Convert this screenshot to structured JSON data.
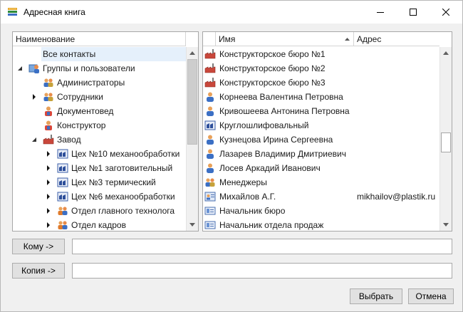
{
  "window": {
    "title": "Адресная книга"
  },
  "left_panel": {
    "column_header": "Наименование",
    "rows": [
      {
        "label": "Все контакты",
        "icon": "none",
        "expander": "none",
        "selected": true
      },
      {
        "label": "Группы и пользователи",
        "icon": "groups-users-icon",
        "expander": "expanded"
      },
      {
        "label": "Администраторы",
        "icon": "group-icon",
        "expander": "none"
      },
      {
        "label": "Сотрудники",
        "icon": "group-icon",
        "expander": "collapsed"
      },
      {
        "label": "Документовед",
        "icon": "user-role-icon",
        "expander": "none"
      },
      {
        "label": "Конструктор",
        "icon": "user-role-icon",
        "expander": "none"
      },
      {
        "label": "Завод",
        "icon": "factory-icon",
        "expander": "expanded"
      },
      {
        "label": "Цех №10 механообработки",
        "icon": "workshop-icon",
        "expander": "collapsed"
      },
      {
        "label": "Цех №1 заготовительный",
        "icon": "workshop-icon",
        "expander": "collapsed"
      },
      {
        "label": "Цех №3 термический",
        "icon": "workshop-icon",
        "expander": "collapsed"
      },
      {
        "label": "Цех №6 механообработки",
        "icon": "workshop-icon",
        "expander": "collapsed"
      },
      {
        "label": "Отдел главного технолога",
        "icon": "department-icon",
        "expander": "collapsed"
      },
      {
        "label": "Отдел кадров",
        "icon": "department-icon",
        "expander": "collapsed"
      }
    ]
  },
  "right_panel": {
    "columns": {
      "name": "Имя",
      "address": "Адрес"
    },
    "rows": [
      {
        "name": "Конструкторское бюро №1",
        "address": "",
        "icon": "bureau-icon"
      },
      {
        "name": "Конструкторское бюро №2",
        "address": "",
        "icon": "bureau-icon"
      },
      {
        "name": "Конструкторское бюро №3",
        "address": "",
        "icon": "bureau-icon"
      },
      {
        "name": "Корнеева Валентина Петровна",
        "address": "",
        "icon": "person-icon"
      },
      {
        "name": "Кривошеева Антонина Петровна",
        "address": "",
        "icon": "person-icon"
      },
      {
        "name": "Круглошлифовальный",
        "address": "",
        "icon": "workshop-icon"
      },
      {
        "name": "Кузнецова Ирина Сергеевна",
        "address": "",
        "icon": "person-icon"
      },
      {
        "name": "Лазарев Владимир Дмитриевич",
        "address": "",
        "icon": "person-icon"
      },
      {
        "name": "Лосев Аркадий Иванович",
        "address": "",
        "icon": "person-icon"
      },
      {
        "name": "Менеджеры",
        "address": "",
        "icon": "group-icon"
      },
      {
        "name": "Михайлов А.Г.",
        "address": "mikhailov@plastik.ru",
        "icon": "contact-card-icon"
      },
      {
        "name": "Начальник бюро",
        "address": "",
        "icon": "position-icon"
      },
      {
        "name": "Начальник отдела продаж",
        "address": "",
        "icon": "position-icon"
      }
    ]
  },
  "recipients": {
    "to_label": "Кому ->",
    "to_value": "",
    "cc_label": "Копия ->",
    "cc_value": ""
  },
  "actions": {
    "select_label": "Выбрать",
    "cancel_label": "Отмена"
  }
}
